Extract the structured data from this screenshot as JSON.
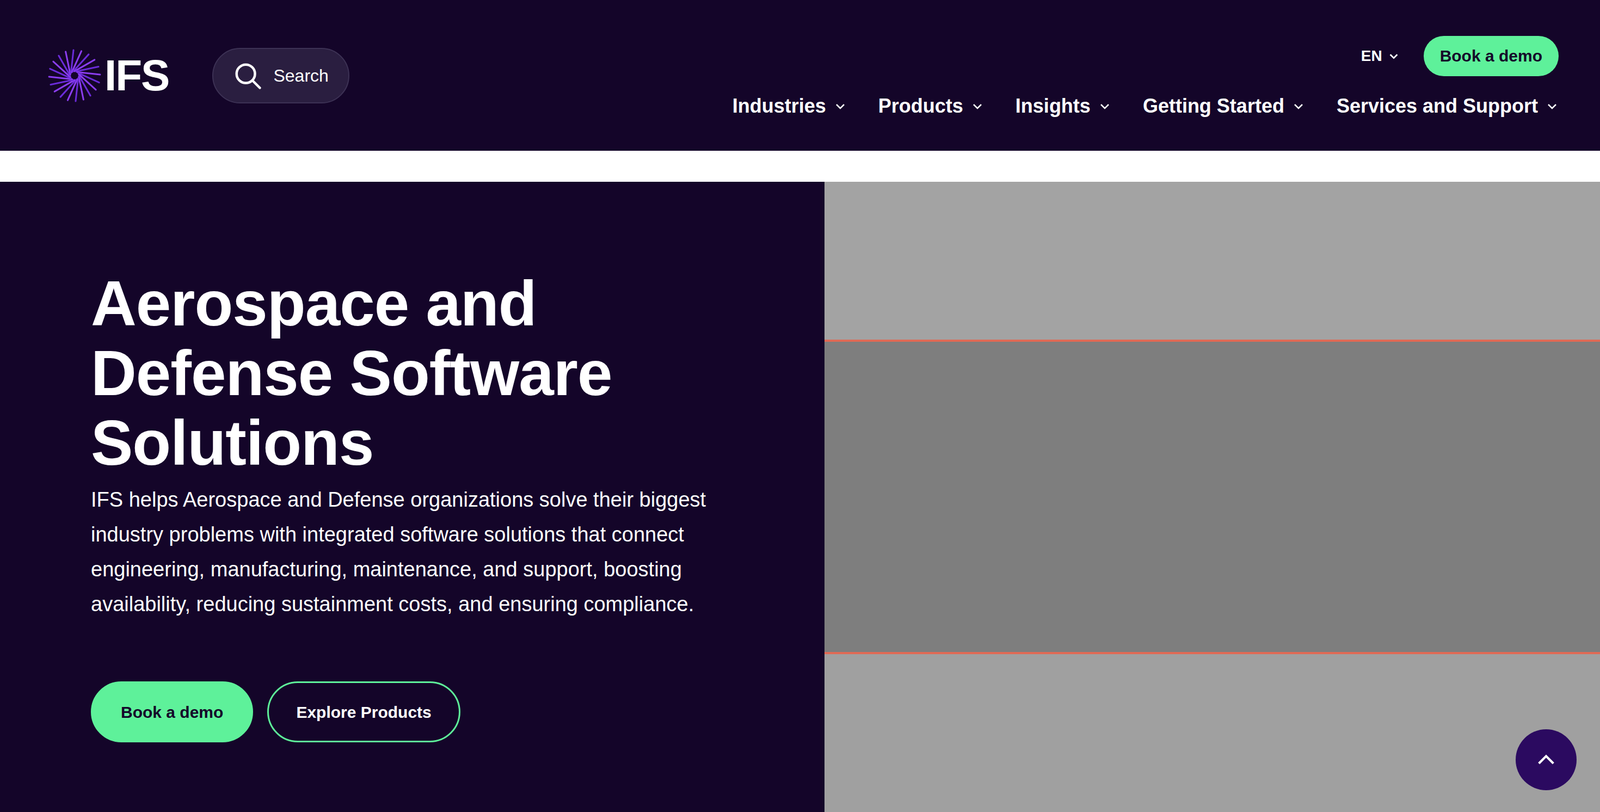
{
  "header": {
    "logo": "IFS",
    "search": {
      "label": "Search"
    },
    "language": "EN",
    "cta": "Book a demo",
    "nav": [
      {
        "label": "Industries"
      },
      {
        "label": "Products"
      },
      {
        "label": "Insights"
      },
      {
        "label": "Getting Started"
      },
      {
        "label": "Services and Support"
      }
    ]
  },
  "hero": {
    "title": "Aerospace and Defense Software Solutions",
    "description": "IFS helps Aerospace and Defense organizations solve their biggest industry problems with integrated software solutions that connect engineering, manufacturing, maintenance, and support, boosting availability, reducing sustainment costs, and ensuring compliance.",
    "buttons": [
      {
        "label": "Book a demo",
        "kind": "primary"
      },
      {
        "label": "Explore Products",
        "kind": "outline"
      }
    ]
  }
}
